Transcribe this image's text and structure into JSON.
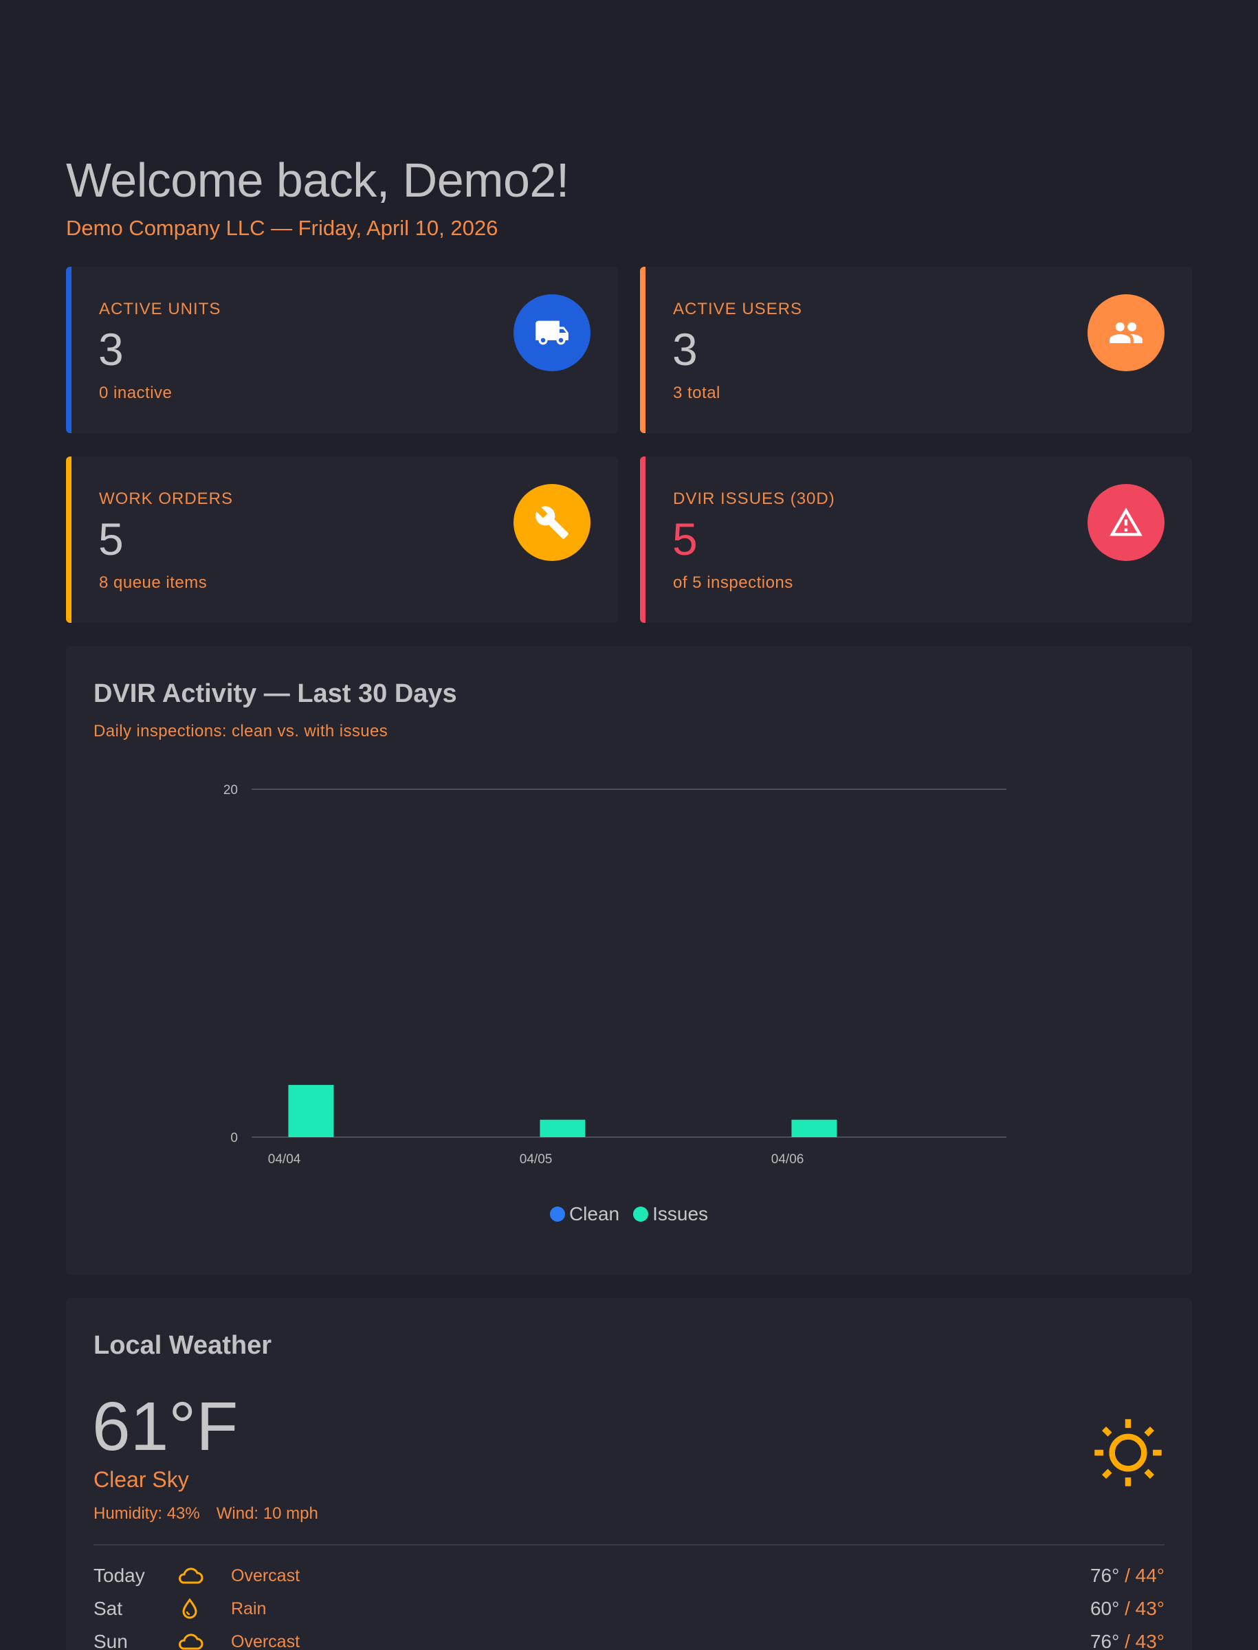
{
  "header": {
    "welcome": "Welcome back, Demo2!",
    "subline": "Demo Company LLC — Friday, April 10, 2026"
  },
  "stats": {
    "units": {
      "label": "ACTIVE UNITS",
      "value": "3",
      "sub": "0 inactive",
      "icon": "truck-icon",
      "accent": "#1f5fdc"
    },
    "users": {
      "label": "ACTIVE USERS",
      "value": "3",
      "sub": "3 total",
      "icon": "users-icon",
      "accent": "#ff8c42"
    },
    "orders": {
      "label": "WORK ORDERS",
      "value": "5",
      "sub": "8 queue items",
      "icon": "wrench-icon",
      "accent": "#ffaa00"
    },
    "dvir": {
      "label": "DVIR ISSUES (30D)",
      "value": "5",
      "sub": "of 5 inspections",
      "icon": "warning-icon",
      "accent": "#f0475f"
    }
  },
  "chart_card": {
    "title": "DVIR Activity — Last 30 Days",
    "subtitle": "Daily inspections: clean vs. with issues"
  },
  "chart_data": {
    "type": "bar",
    "categories": [
      "04/04",
      "04/05",
      "04/06"
    ],
    "series": [
      {
        "name": "Clean",
        "color": "#2d7bf4",
        "values": [
          0,
          0,
          0
        ]
      },
      {
        "name": "Issues",
        "color": "#1de9b6",
        "values": [
          3,
          1,
          1
        ]
      }
    ],
    "ylim": [
      0,
      20
    ],
    "yticks": [
      "0",
      "20"
    ],
    "grid": true,
    "legend": "bottom"
  },
  "weather": {
    "title": "Local Weather",
    "temp": "61°F",
    "condition": "Clear Sky",
    "humidity": "Humidity: 43%",
    "wind": "Wind: 10 mph",
    "icon": "sun-icon",
    "forecast": [
      {
        "day": "Today",
        "icon": "cloud-icon",
        "desc": "Overcast",
        "hi": "76°",
        "lo": " / 44°"
      },
      {
        "day": "Sat",
        "icon": "raindrop-icon",
        "desc": "Rain",
        "hi": "60°",
        "lo": " / 43°"
      },
      {
        "day": "Sun",
        "icon": "cloud-icon",
        "desc": "Overcast",
        "hi": "76°",
        "lo": " / 43°"
      }
    ]
  }
}
